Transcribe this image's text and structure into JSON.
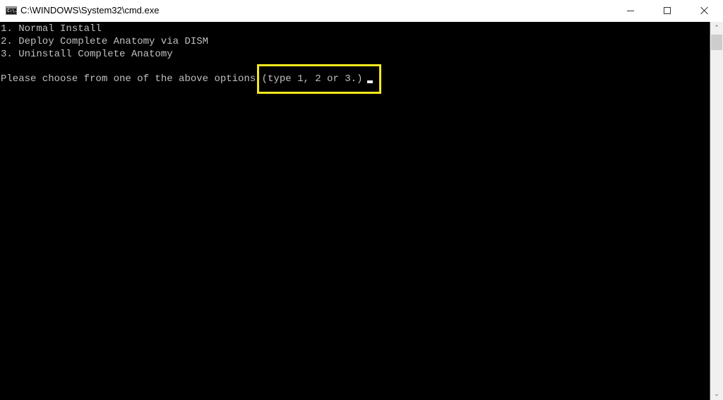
{
  "window": {
    "title": "C:\\WINDOWS\\System32\\cmd.exe",
    "app_icon": "cmd-icon",
    "app_icon_text": "C:\\.",
    "controls": {
      "minimize": "minimize-icon",
      "maximize": "maximize-icon",
      "close": "close-icon"
    }
  },
  "console": {
    "lines": [
      "1. Normal Install",
      "2. Deploy Complete Anatomy via DISM",
      "3. Uninstall Complete Anatomy",
      "",
      "Please choose from one of the above options (type 1, 2 or 3.) "
    ],
    "highlight_color": "#f5e81e",
    "background_color": "#000000",
    "text_color": "#c0c0c0"
  },
  "scrollbar": {
    "up_glyph": "⌃",
    "down_glyph": "⌄"
  }
}
